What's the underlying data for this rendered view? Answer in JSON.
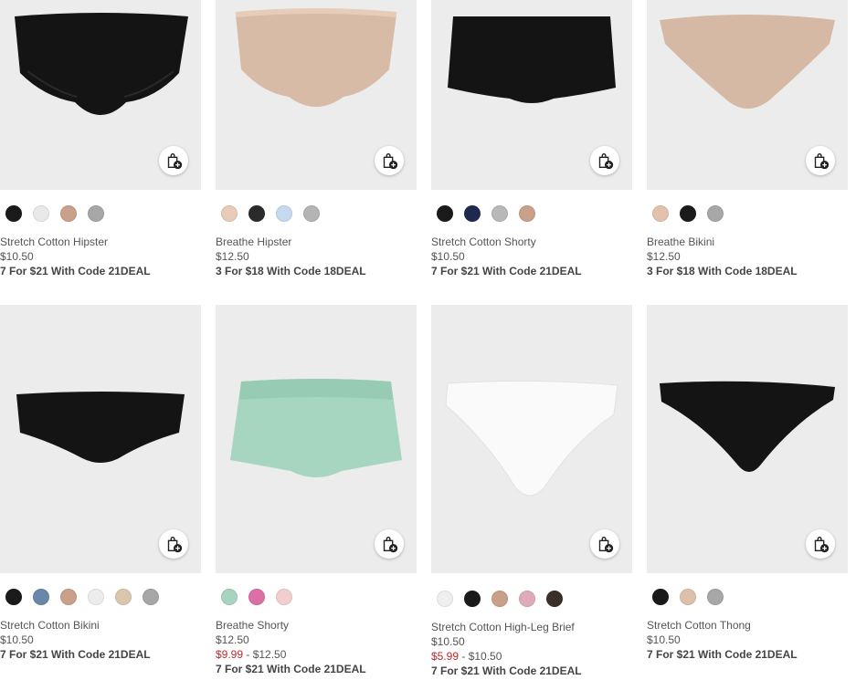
{
  "products": [
    {
      "name": "Stretch Cotton Hipster",
      "price": "$10.50",
      "promo": "7 For $21 With Code 21DEAL",
      "swatches": [
        "#1a1a1a",
        "#e9e9e9",
        "#c9a08a",
        "#a7a7a7"
      ]
    },
    {
      "name": "Breathe Hipster",
      "price": "$12.50",
      "promo": "3 For $18 With Code 18DEAL",
      "swatches": [
        "#e8cbb8",
        "#2b2b2b",
        "#c5d9ef",
        "#b4b4b4"
      ]
    },
    {
      "name": "Stretch Cotton Shorty",
      "price": "$10.50",
      "promo": "7 For $21 With Code 21DEAL",
      "swatches": [
        "#1a1a1a",
        "#1e2a4d",
        "#b8b8b8",
        "#c9a08a"
      ]
    },
    {
      "name": "Breathe Bikini",
      "price": "$12.50",
      "promo": "3 For $18 With Code 18DEAL",
      "swatches": [
        "#e3c2ad",
        "#1a1a1a",
        "#a7a7a7"
      ]
    },
    {
      "name": "Stretch Cotton Bikini",
      "price": "$10.50",
      "promo": "7 For $21 With Code 21DEAL",
      "swatches": [
        "#1a1a1a",
        "#6a86a8",
        "#c9a08a",
        "#ececec",
        "#d9c6ac",
        "#a7a7a7"
      ]
    },
    {
      "name": "Breathe Shorty",
      "price": "$12.50",
      "sale_price": "$9.99",
      "sale_range_rest": " - $12.50",
      "promo": "7 For $21 With Code 21DEAL",
      "swatches": [
        "#a8d3bf",
        "#dc6fa6",
        "#f2cfcf"
      ]
    },
    {
      "name": "Stretch Cotton High-Leg Brief",
      "price": "$10.50",
      "sale_price": "$5.99",
      "sale_range_rest": " - $10.50",
      "promo": "7 For $21 With Code 21DEAL",
      "swatches": [
        "#efefef",
        "#1a1a1a",
        "#c9a08a",
        "#e0aab8",
        "#3a2f2a"
      ]
    },
    {
      "name": "Stretch Cotton Thong",
      "price": "$10.50",
      "promo": "7 For $21 With Code 21DEAL",
      "swatches": [
        "#1a1a1a",
        "#dcc0ab",
        "#a7a7a7"
      ]
    }
  ],
  "icons": {
    "add_to_bag": "shopping-bag-plus-icon"
  }
}
